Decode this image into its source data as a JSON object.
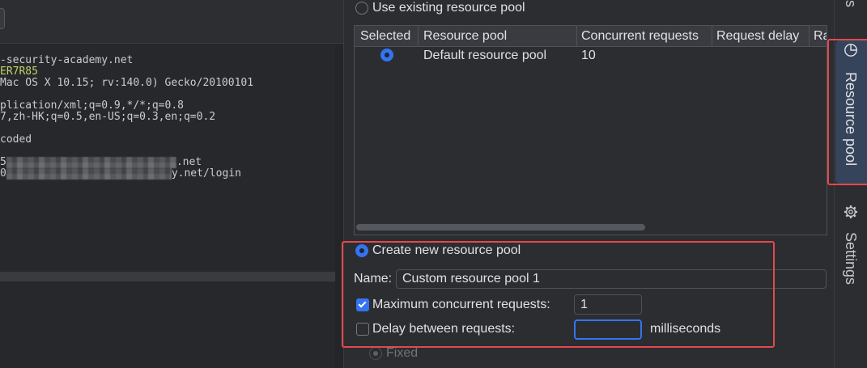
{
  "colors": {
    "accent": "#3574f0",
    "annotation": "#e5484d",
    "cookie_value": "#c3d36a"
  },
  "request_editor": {
    "lines": [
      "-security-academy.net",
      "ER7R85",
      "Mac OS X 10.15; rv:140.0) Gecko/20100101",
      "plication/xml;q=0.9,*/*;q=0.8",
      "7,zh-HK;q=0.5,en-US;q=0.3,en;q=0.2",
      "coded"
    ],
    "redacted_lines": [
      {
        "prefix": "5",
        "suffix": ".net"
      },
      {
        "prefix": "0",
        "suffix": "y.net/login"
      }
    ]
  },
  "resource_pool": {
    "use_existing": {
      "label": "Use existing resource pool",
      "selected": false
    },
    "table": {
      "columns": [
        "Selected",
        "Resource pool",
        "Concurrent requests",
        "Request delay",
        "Ra"
      ],
      "rows": [
        {
          "selected": true,
          "resource_pool": "Default resource pool",
          "concurrent_requests": "10"
        }
      ]
    },
    "create_new": {
      "label": "Create new resource pool",
      "selected": true
    },
    "name": {
      "label": "Name:",
      "value": "Custom resource pool 1"
    },
    "max_concurrent": {
      "label": "Maximum concurrent requests:",
      "checked": true,
      "value": "1"
    },
    "delay": {
      "label": "Delay between requests:",
      "checked": false,
      "focused": true,
      "unit": "milliseconds"
    },
    "fixed": {
      "label": "Fixed",
      "selected": true,
      "enabled": false
    }
  },
  "sidebar": {
    "tabs": [
      {
        "label": "s"
      },
      {
        "label": "Resource pool",
        "icon": "pie-chart-icon",
        "active": true
      },
      {
        "label": "Settings",
        "icon": "gear-icon",
        "active": false
      }
    ]
  }
}
